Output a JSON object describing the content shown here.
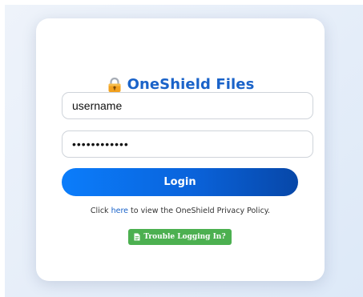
{
  "brand": {
    "title": "OneShield Files",
    "icon": "lock-icon",
    "color": "#1a63c9"
  },
  "form": {
    "username_value": "username",
    "password_value": "••••••••••••",
    "login_label": "Login"
  },
  "policy": {
    "prefix": "Click ",
    "link_text": "here",
    "suffix": " to view the OneShield Privacy Policy."
  },
  "trouble": {
    "label": "Trouble Logging In?",
    "icon": "document-icon",
    "color": "#4cb050"
  },
  "colors": {
    "accent": "#0a63db",
    "background": "#e6eef9"
  }
}
